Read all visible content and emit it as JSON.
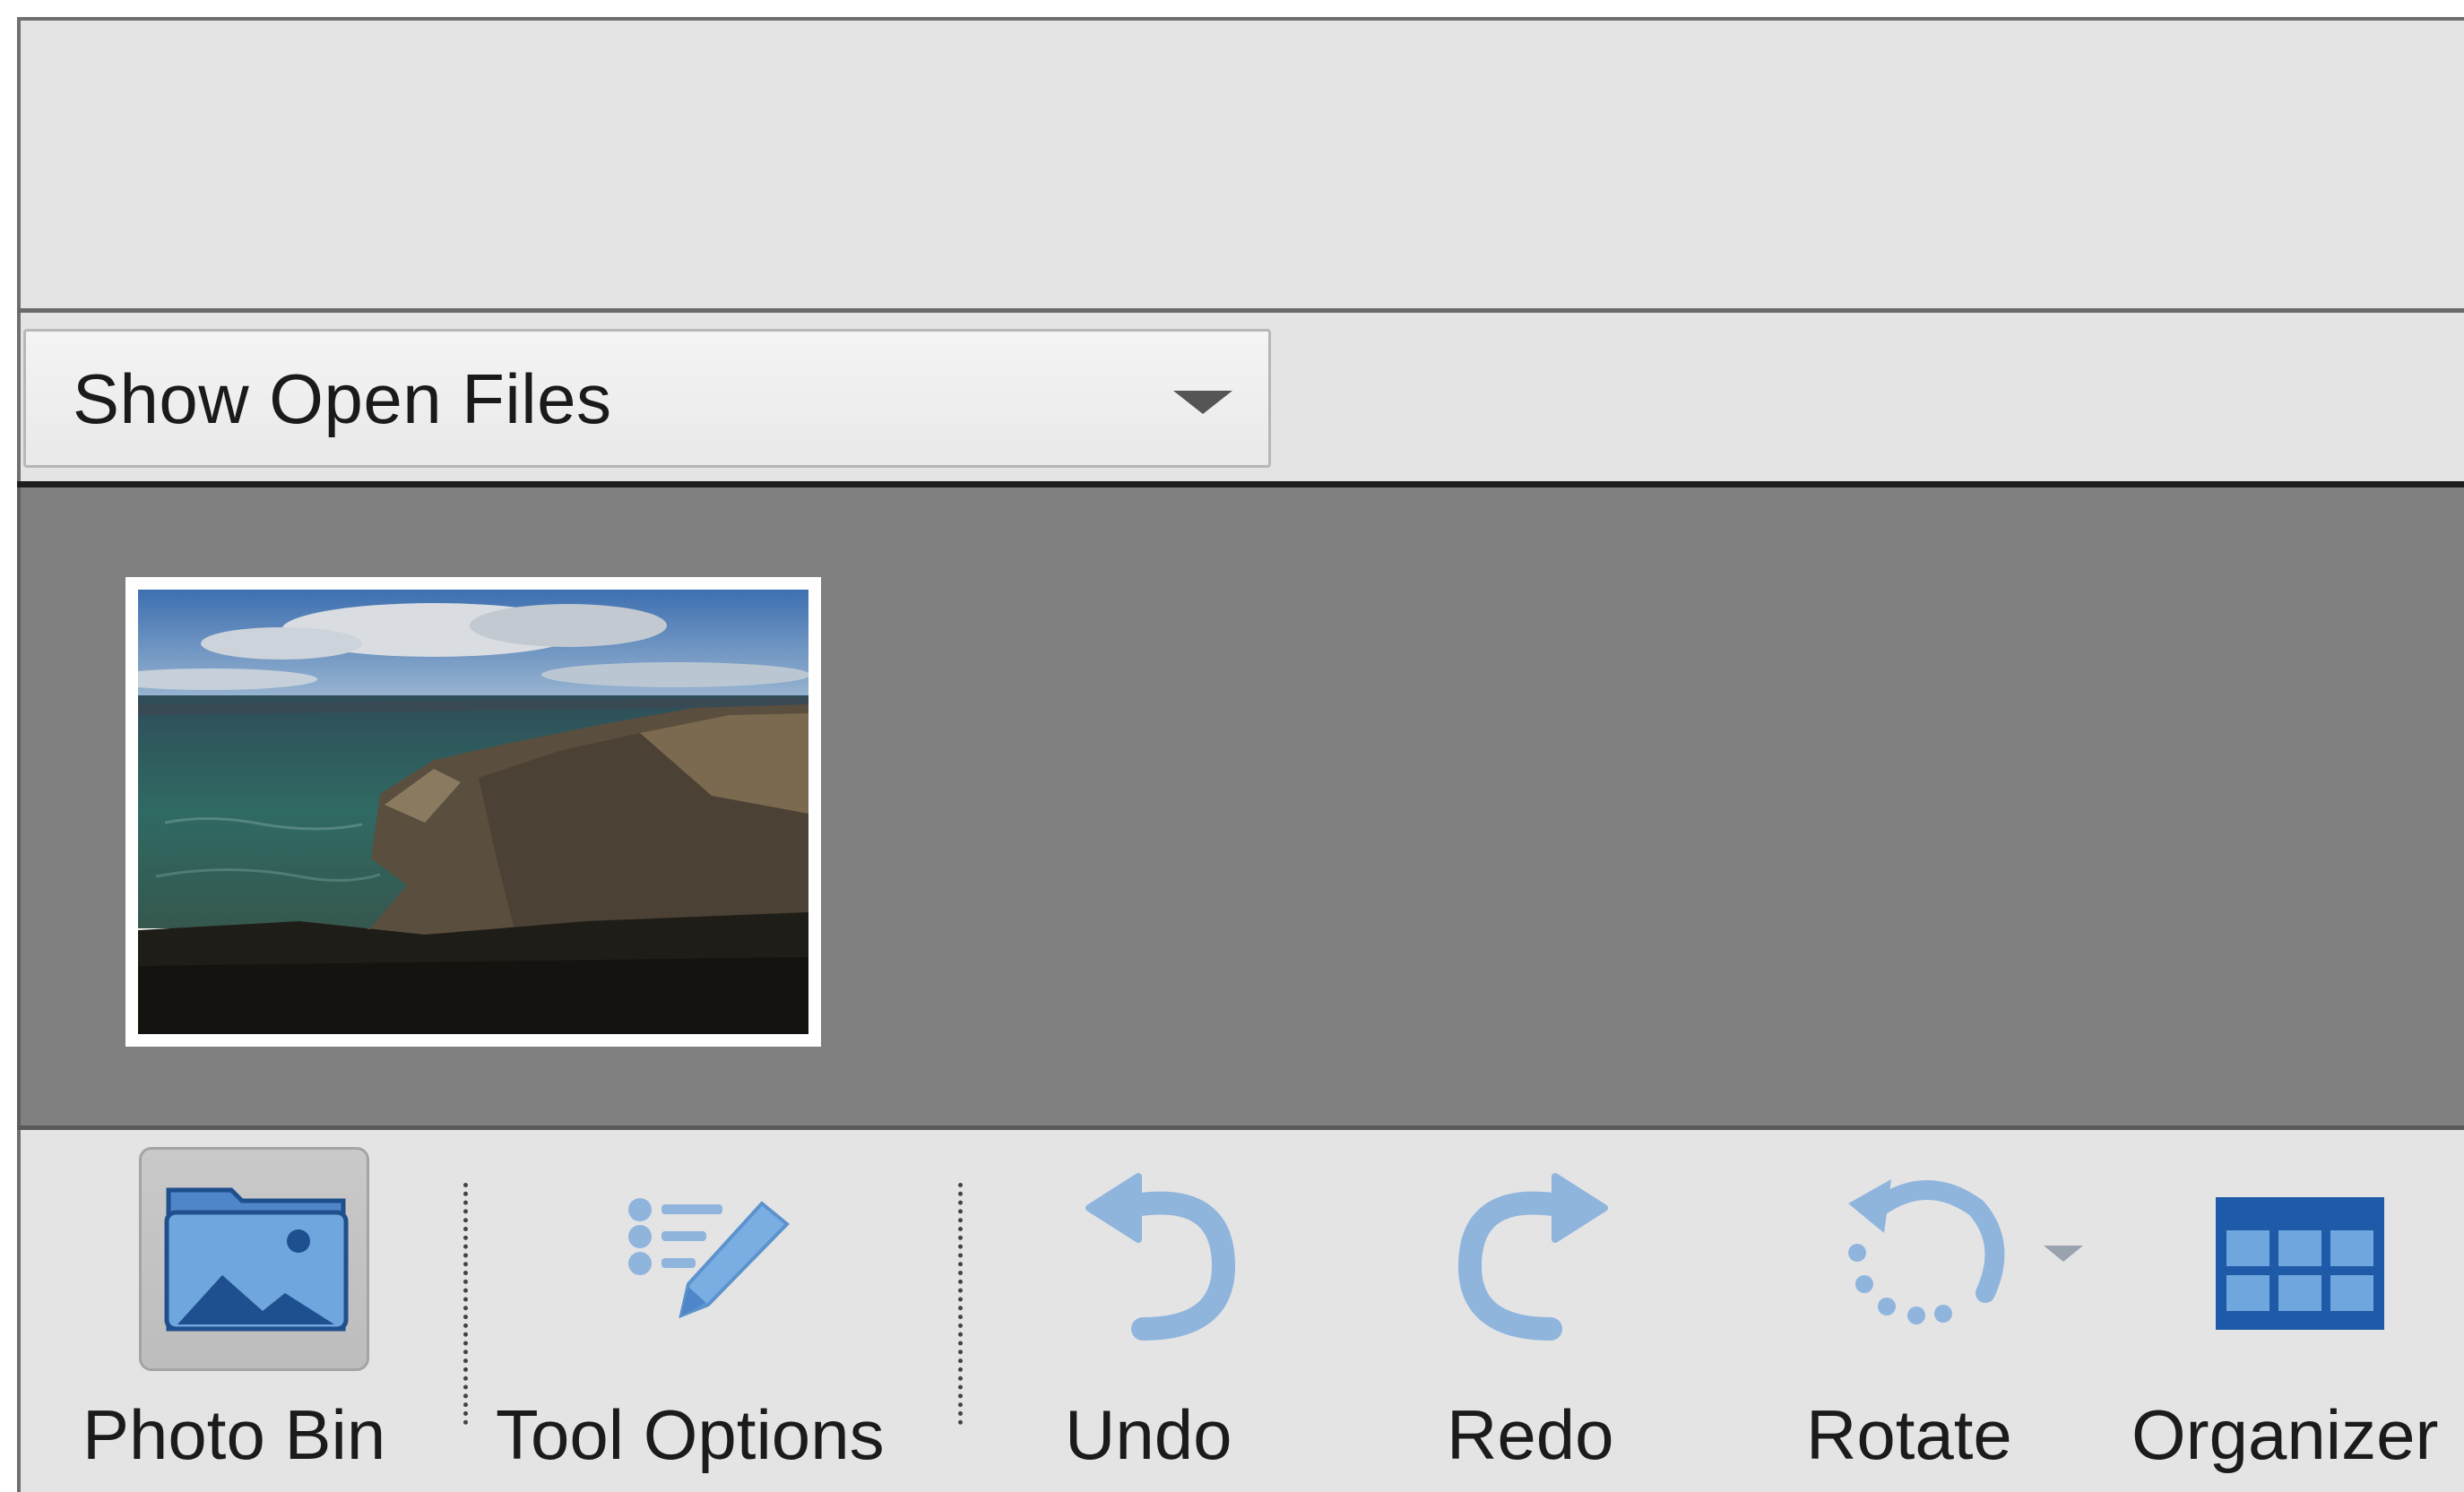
{
  "bin_header": {
    "dropdown_value": "Show Open Files"
  },
  "photo_bin": {
    "thumbnails": [
      {
        "icon": "sea-cliff-photo"
      }
    ]
  },
  "taskbar": {
    "photo_bin_label": "Photo Bin",
    "tool_options_label": "Tool Options",
    "undo_label": "Undo",
    "redo_label": "Redo",
    "rotate_label": "Rotate",
    "organizer_label": "Organizer"
  },
  "colors": {
    "panel_bg": "#e4e4e5",
    "bin_bg": "#808080",
    "icon_blue": "#6fa6dd",
    "icon_dark_blue": "#1e5aa8",
    "active_button_bg": "#c4c4c4"
  }
}
